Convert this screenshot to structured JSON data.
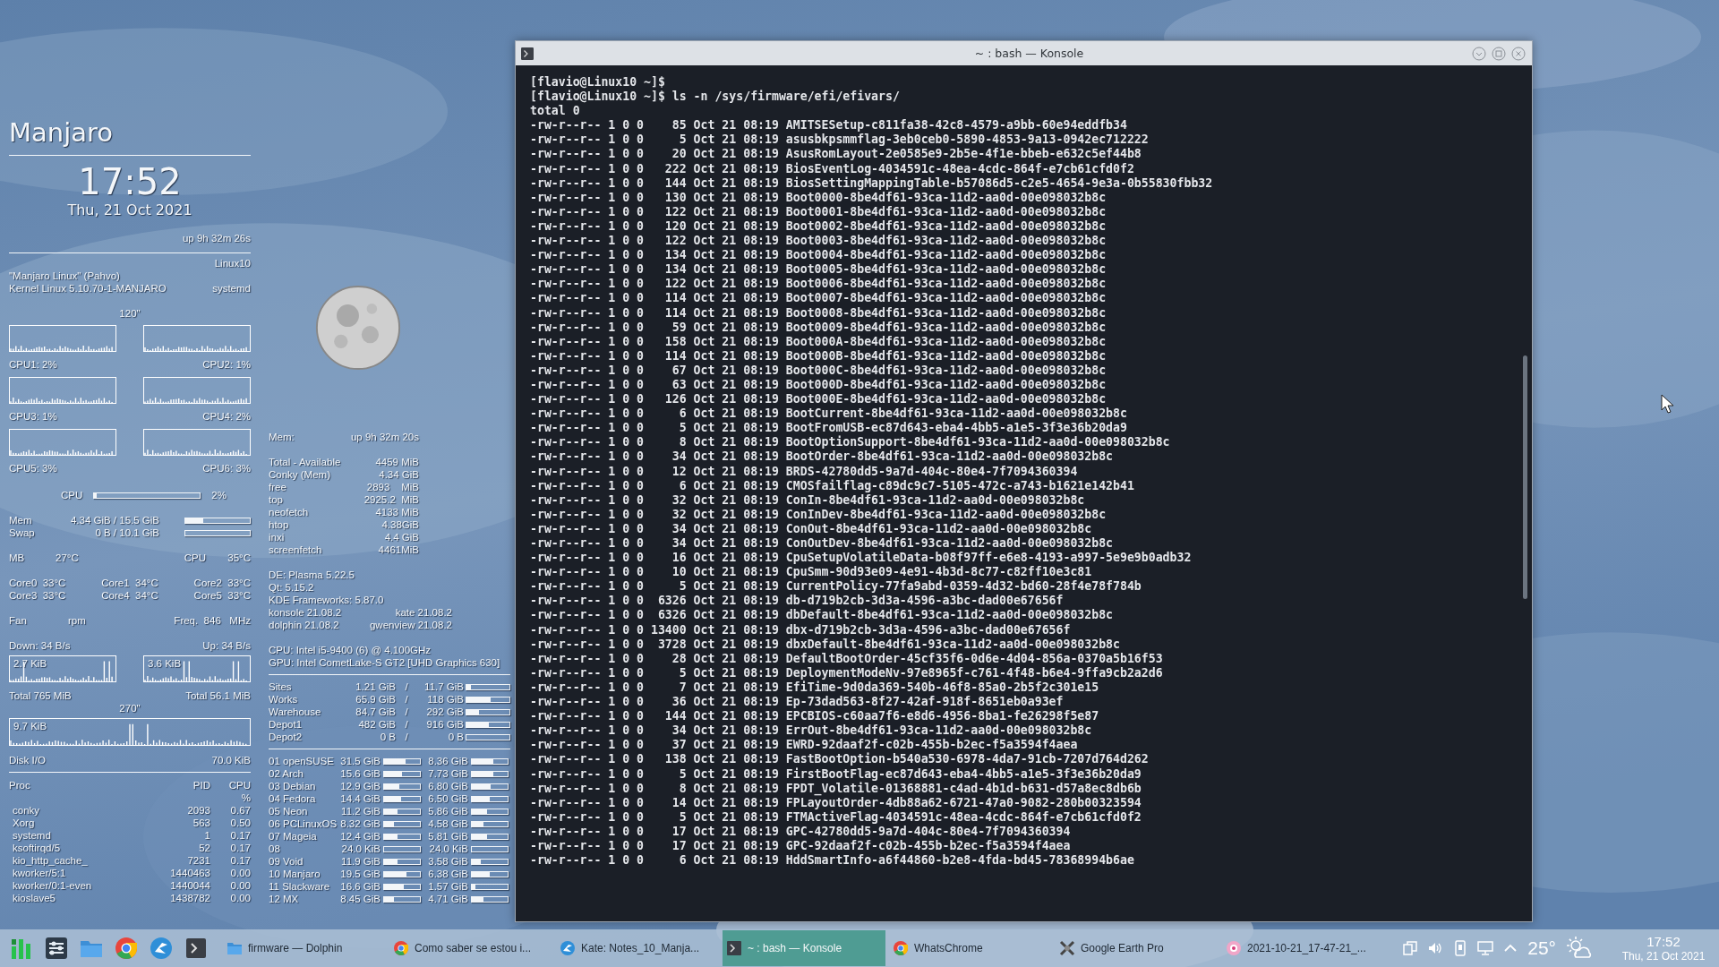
{
  "conky": {
    "title": "Manjaro",
    "time": "17:52",
    "date": "Thu, 21 Oct 2021",
    "uptime": "up  9h 32m 26s",
    "host": "Linux10",
    "distro": "\"Manjaro Linux\" (Pahvo)",
    "kernel": "Kernel Linux 5.10.70-1-MANJARO",
    "init": "systemd",
    "cpu_interval": "120\"",
    "cpus": [
      {
        "label": "CPU1: 2%"
      },
      {
        "label": "CPU2: 1%"
      },
      {
        "label": "CPU3: 1%"
      },
      {
        "label": "CPU4: 2%"
      },
      {
        "label": "CPU5: 3%"
      },
      {
        "label": "CPU6: 3%"
      }
    ],
    "cpu_total": {
      "label": "CPU",
      "level": 0.02,
      "reading": "2%"
    },
    "memory": [
      {
        "label": "Mem",
        "reading": "4.34 GiB / 15.5 GiB",
        "level": 0.28
      },
      {
        "label": "Swap",
        "reading": "0 B / 10.1 GiB"
      }
    ],
    "temps": {
      "mb_label": "MB",
      "mb": "27°C",
      "cpu_label": "CPU",
      "cpu": "35°C"
    },
    "cores": [
      "Core0  33°C",
      "Core1  34°C",
      "Core2  33°C",
      "Core3  33°C",
      "Core4  34°C",
      "Core5  33°C"
    ],
    "fan": {
      "label": "Fan",
      "reading": "rpm",
      "freq": "Freq.  846   MHz"
    },
    "net": {
      "down": "Down: 34 B/s",
      "up": "Up: 34 B/s",
      "down_peak": "2.7 KiB",
      "up_peak": "3.6 KiB",
      "down_total": "Total 765 MiB",
      "up_total": "Total 56.1 MiB"
    },
    "disk": {
      "interval": "270\"",
      "peak": "9.7 KiB",
      "label": "Disk I/O",
      "reading": "70.0 KiB"
    },
    "proc": {
      "columns": [
        "Proc",
        "PID",
        "CPU"
      ],
      "unit": "%",
      "rows": [
        {
          "name": "conky",
          "pid": "2093",
          "cpu": "0.67"
        },
        {
          "name": "Xorg",
          "pid": "563",
          "cpu": "0.50"
        },
        {
          "name": "systemd",
          "pid": "1",
          "cpu": "0.17"
        },
        {
          "name": "ksoftirqd/5",
          "pid": "52",
          "cpu": "0.17"
        },
        {
          "name": "kio_http_cache_",
          "pid": "7231",
          "cpu": "0.17"
        },
        {
          "name": "kworker/5:1",
          "pid": "1440463",
          "cpu": "0.00"
        },
        {
          "name": "kworker/0:1-even",
          "pid": "1440044",
          "cpu": "0.00"
        },
        {
          "name": "kioslave5",
          "pid": "1438782",
          "cpu": "0.00"
        }
      ]
    }
  },
  "conky2": {
    "mem_label": "Mem:",
    "uptime": "up  9h 32m 20s",
    "mem_rows": [
      {
        "label": "Total - Available",
        "value": "4459 MiB"
      },
      {
        "label": "Conky (Mem)",
        "value": "4.34 GiB"
      },
      {
        "label": "free",
        "value": "2893    MiB"
      },
      {
        "label": "top",
        "value": "2925.2  MiB"
      },
      {
        "label": "neofetch",
        "value": "4133 MiB"
      },
      {
        "label": "htop",
        "value": "4.38GiB"
      },
      {
        "label": "inxi",
        "value": "4.4 GiB"
      },
      {
        "label": "screenfetch",
        "value": "4461MiB"
      }
    ],
    "versions": [
      [
        "DE: Plasma 5.22.5"
      ],
      [
        "Qt: 5.15.2"
      ],
      [
        "KDE Frameworks: 5.87.0"
      ],
      [
        "konsole 21.08.2",
        "kate 21.08.2"
      ],
      [
        "dolphin 21.08.2",
        "gwenview 21.08.2"
      ]
    ],
    "hardware": [
      "CPU: Intel i5-9400 (6) @ 4.100GHz",
      "GPU: Intel CometLake-S GT2 [UHD Graphics 630]"
    ],
    "drives": [
      {
        "name": "Sites",
        "used": "1.21 GiB",
        "sep": "/",
        "total": "11.7 GiB",
        "level": 0.1
      },
      {
        "name": "Works",
        "used": "65.9 GiB",
        "sep": "/",
        "total": "118 GiB",
        "level": 0.56
      },
      {
        "name": "Warehouse",
        "used": "84.7 GiB",
        "sep": "/",
        "total": "292 GiB",
        "level": 0.29
      },
      {
        "name": "Depot1",
        "used": "482 GiB",
        "sep": "/",
        "total": "916 GiB",
        "level": 0.53
      },
      {
        "name": "Depot2",
        "used": "0 B",
        "sep": "/",
        "total": "0 B"
      }
    ],
    "partitions": [
      {
        "name": "01 openSUSE",
        "bars": [
          {
            "size": "31.5 GiB",
            "level": 0.6
          },
          {
            "size": "8.36 GiB",
            "level": 0.6
          }
        ]
      },
      {
        "name": "02 Arch",
        "bars": [
          {
            "size": "15.6 GiB",
            "level": 0.5
          },
          {
            "size": "7.73 GiB",
            "level": 0.6
          }
        ]
      },
      {
        "name": "03 Debian",
        "bars": [
          {
            "size": "12.9 GiB",
            "level": 0.42
          },
          {
            "size": "6.80 GiB",
            "level": 0.52
          }
        ]
      },
      {
        "name": "04 Fedora",
        "bars": [
          {
            "size": "14.4 GiB",
            "level": 0.47
          },
          {
            "size": "6.50 GiB",
            "level": 0.5
          }
        ]
      },
      {
        "name": "05 Neon",
        "bars": [
          {
            "size": "11.2 GiB",
            "level": 0.38
          },
          {
            "size": "5.86 GiB",
            "level": 0.43
          }
        ]
      },
      {
        "name": "06 PCLinuxOS",
        "bars": [
          {
            "size": "8.32 GiB",
            "level": 0.27
          },
          {
            "size": "4.58 GiB",
            "level": 0.33
          }
        ]
      },
      {
        "name": "07 Mageia",
        "bars": [
          {
            "size": "12.4 GiB",
            "level": 0.38
          },
          {
            "size": "5.81 GiB",
            "level": 0.43
          }
        ]
      },
      {
        "name": "08",
        "bars": [
          {
            "size": "24.0 KiB"
          },
          {
            "size": "24.0 KiB"
          }
        ]
      },
      {
        "name": "09 Void",
        "bars": [
          {
            "size": "11.9 GiB",
            "level": 0.38
          },
          {
            "size": "3.58 GiB",
            "level": 0.25
          }
        ]
      },
      {
        "name": "10 Manjaro",
        "bars": [
          {
            "size": "19.5 GiB",
            "level": 0.63
          },
          {
            "size": "6.38 GiB",
            "level": 0.5
          }
        ]
      },
      {
        "name": "11 Slackware",
        "bars": [
          {
            "size": "16.6 GiB",
            "level": 0.55
          },
          {
            "size": "1.57 GiB",
            "level": 0.1
          }
        ]
      },
      {
        "name": "12 MX",
        "bars": [
          {
            "size": "8.45 GiB",
            "level": 0.27
          },
          {
            "size": "4.71 GiB",
            "level": 0.33
          }
        ]
      }
    ]
  },
  "terminal": {
    "title": "~ : bash — Konsole",
    "lines": [
      "[flavio@Linux10 ~]$",
      "[flavio@Linux10 ~]$ ls -n /sys/firmware/efi/efivars/",
      "total 0",
      "-rw-r--r-- 1 0 0    85 Oct 21 08:19 AMITSESetup-c811fa38-42c8-4579-a9bb-60e94eddfb34",
      "-rw-r--r-- 1 0 0     5 Oct 21 08:19 asusbkpsmmflag-3eb0ceb0-5890-4853-9a13-0942ec712222",
      "-rw-r--r-- 1 0 0    20 Oct 21 08:19 AsusRomLayout-2e0585e9-2b5e-4f1e-bbeb-e632c5ef44b8",
      "-rw-r--r-- 1 0 0   222 Oct 21 08:19 BiosEventLog-4034591c-48ea-4cdc-864f-e7cb61cfd0f2",
      "-rw-r--r-- 1 0 0   144 Oct 21 08:19 BiosSettingMappingTable-b57086d5-c2e5-4654-9e3a-0b55830fbb32",
      "-rw-r--r-- 1 0 0   130 Oct 21 08:19 Boot0000-8be4df61-93ca-11d2-aa0d-00e098032b8c",
      "-rw-r--r-- 1 0 0   122 Oct 21 08:19 Boot0001-8be4df61-93ca-11d2-aa0d-00e098032b8c",
      "-rw-r--r-- 1 0 0   120 Oct 21 08:19 Boot0002-8be4df61-93ca-11d2-aa0d-00e098032b8c",
      "-rw-r--r-- 1 0 0   122 Oct 21 08:19 Boot0003-8be4df61-93ca-11d2-aa0d-00e098032b8c",
      "-rw-r--r-- 1 0 0   134 Oct 21 08:19 Boot0004-8be4df61-93ca-11d2-aa0d-00e098032b8c",
      "-rw-r--r-- 1 0 0   134 Oct 21 08:19 Boot0005-8be4df61-93ca-11d2-aa0d-00e098032b8c",
      "-rw-r--r-- 1 0 0   122 Oct 21 08:19 Boot0006-8be4df61-93ca-11d2-aa0d-00e098032b8c",
      "-rw-r--r-- 1 0 0   114 Oct 21 08:19 Boot0007-8be4df61-93ca-11d2-aa0d-00e098032b8c",
      "-rw-r--r-- 1 0 0   114 Oct 21 08:19 Boot0008-8be4df61-93ca-11d2-aa0d-00e098032b8c",
      "-rw-r--r-- 1 0 0    59 Oct 21 08:19 Boot0009-8be4df61-93ca-11d2-aa0d-00e098032b8c",
      "-rw-r--r-- 1 0 0   158 Oct 21 08:19 Boot000A-8be4df61-93ca-11d2-aa0d-00e098032b8c",
      "-rw-r--r-- 1 0 0   114 Oct 21 08:19 Boot000B-8be4df61-93ca-11d2-aa0d-00e098032b8c",
      "-rw-r--r-- 1 0 0    67 Oct 21 08:19 Boot000C-8be4df61-93ca-11d2-aa0d-00e098032b8c",
      "-rw-r--r-- 1 0 0    63 Oct 21 08:19 Boot000D-8be4df61-93ca-11d2-aa0d-00e098032b8c",
      "-rw-r--r-- 1 0 0   126 Oct 21 08:19 Boot000E-8be4df61-93ca-11d2-aa0d-00e098032b8c",
      "-rw-r--r-- 1 0 0     6 Oct 21 08:19 BootCurrent-8be4df61-93ca-11d2-aa0d-00e098032b8c",
      "-rw-r--r-- 1 0 0     5 Oct 21 08:19 BootFromUSB-ec87d643-eba4-4bb5-a1e5-3f3e36b20da9",
      "-rw-r--r-- 1 0 0     8 Oct 21 08:19 BootOptionSupport-8be4df61-93ca-11d2-aa0d-00e098032b8c",
      "-rw-r--r-- 1 0 0    34 Oct 21 08:19 BootOrder-8be4df61-93ca-11d2-aa0d-00e098032b8c",
      "-rw-r--r-- 1 0 0    12 Oct 21 08:19 BRDS-42780dd5-9a7d-404c-80e4-7f7094360394",
      "-rw-r--r-- 1 0 0     6 Oct 21 08:19 CMOSfailflag-c89dc9c7-5105-472c-a743-b1621e142b41",
      "-rw-r--r-- 1 0 0    32 Oct 21 08:19 ConIn-8be4df61-93ca-11d2-aa0d-00e098032b8c",
      "-rw-r--r-- 1 0 0    32 Oct 21 08:19 ConInDev-8be4df61-93ca-11d2-aa0d-00e098032b8c",
      "-rw-r--r-- 1 0 0    34 Oct 21 08:19 ConOut-8be4df61-93ca-11d2-aa0d-00e098032b8c",
      "-rw-r--r-- 1 0 0    34 Oct 21 08:19 ConOutDev-8be4df61-93ca-11d2-aa0d-00e098032b8c",
      "-rw-r--r-- 1 0 0    16 Oct 21 08:19 CpuSetupVolatileData-b08f97ff-e6e8-4193-a997-5e9e9b0adb32",
      "-rw-r--r-- 1 0 0    10 Oct 21 08:19 CpuSmm-90d93e09-4e91-4b3d-8c77-c82ff10e3c81",
      "-rw-r--r-- 1 0 0     5 Oct 21 08:19 CurrentPolicy-77fa9abd-0359-4d32-bd60-28f4e78f784b",
      "-rw-r--r-- 1 0 0  6326 Oct 21 08:19 db-d719b2cb-3d3a-4596-a3bc-dad00e67656f",
      "-rw-r--r-- 1 0 0  6326 Oct 21 08:19 dbDefault-8be4df61-93ca-11d2-aa0d-00e098032b8c",
      "-rw-r--r-- 1 0 0 13400 Oct 21 08:19 dbx-d719b2cb-3d3a-4596-a3bc-dad00e67656f",
      "-rw-r--r-- 1 0 0  3728 Oct 21 08:19 dbxDefault-8be4df61-93ca-11d2-aa0d-00e098032b8c",
      "-rw-r--r-- 1 0 0    28 Oct 21 08:19 DefaultBootOrder-45cf35f6-0d6e-4d04-856a-0370a5b16f53",
      "-rw-r--r-- 1 0 0     5 Oct 21 08:19 DeploymentModeNv-97e8965f-c761-4f48-b6e4-9ffa9cb2a2d6",
      "-rw-r--r-- 1 0 0     7 Oct 21 08:19 EfiTime-9d0da369-540b-46f8-85a0-2b5f2c301e15",
      "-rw-r--r-- 1 0 0    36 Oct 21 08:19 Ep-73dad563-8f27-42af-918f-8651eb0a93ef",
      "-rw-r--r-- 1 0 0   144 Oct 21 08:19 EPCBIOS-c60aa7f6-e8d6-4956-8ba1-fe26298f5e87",
      "-rw-r--r-- 1 0 0    34 Oct 21 08:19 ErrOut-8be4df61-93ca-11d2-aa0d-00e098032b8c",
      "-rw-r--r-- 1 0 0    37 Oct 21 08:19 EWRD-92daaf2f-c02b-455b-b2ec-f5a3594f4aea",
      "-rw-r--r-- 1 0 0   138 Oct 21 08:19 FastBootOption-b540a530-6978-4da7-91cb-7207d764d262",
      "-rw-r--r-- 1 0 0     5 Oct 21 08:19 FirstBootFlag-ec87d643-eba4-4bb5-a1e5-3f3e36b20da9",
      "-rw-r--r-- 1 0 0     8 Oct 21 08:19 FPDT_Volatile-01368881-c4ad-4b1d-b631-d57a8ec8db6b",
      "-rw-r--r-- 1 0 0    14 Oct 21 08:19 FPLayoutOrder-4db88a62-6721-47a0-9082-280b00323594",
      "-rw-r--r-- 1 0 0     5 Oct 21 08:19 FTMActiveFlag-4034591c-48ea-4cdc-864f-e7cb61cfd0f2",
      "-rw-r--r-- 1 0 0    17 Oct 21 08:19 GPC-42780dd5-9a7d-404c-80e4-7f7094360394",
      "-rw-r--r-- 1 0 0    17 Oct 21 08:19 GPC-92daaf2f-c02b-455b-b2ec-f5a3594f4aea",
      "-rw-r--r-- 1 0 0     6 Oct 21 08:19 HddSmartInfo-a6f44860-b2e8-4fda-bd45-78368994b6ae"
    ]
  },
  "taskbar": {
    "launchers": [
      {
        "kind": "monitor"
      },
      {
        "kind": "settings"
      },
      {
        "kind": "folder"
      },
      {
        "kind": "chrome"
      },
      {
        "kind": "kate"
      },
      {
        "kind": "terminal"
      }
    ],
    "tasks": [
      {
        "kind": "folder",
        "label": "firmware — Dolphin",
        "selected": false
      },
      {
        "kind": "chrome",
        "label": "Como saber se estou i...",
        "selected": false
      },
      {
        "kind": "kate",
        "label": "Kate: Notes_10_Manja...",
        "selected": false
      },
      {
        "kind": "terminal",
        "label": "~ : bash — Konsole",
        "selected": true
      },
      {
        "kind": "chrome",
        "label": "WhatsChrome",
        "selected": false
      },
      {
        "kind": "earth",
        "label": "Google Earth Pro",
        "selected": false
      },
      {
        "kind": "record",
        "label": "2021-10-21_17-47-21_...",
        "selected": false
      }
    ],
    "temperature": "25°",
    "clock": "17:52",
    "date": "Thu, 21 Oct 2021"
  }
}
